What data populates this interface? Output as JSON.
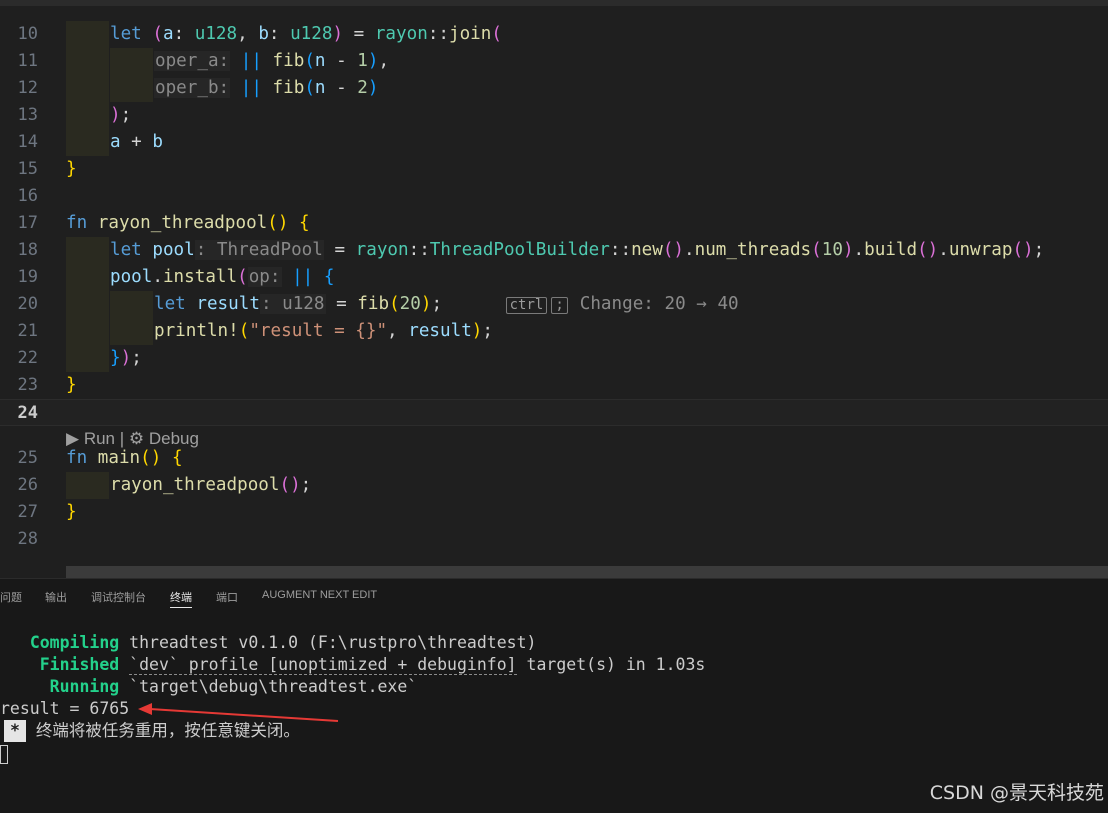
{
  "editor": {
    "lines": [
      {
        "n": "10",
        "spans": [
          [
            "kw",
            "let"
          ],
          [
            "op",
            " "
          ],
          [
            "b2",
            "("
          ],
          [
            "vr",
            "a"
          ],
          [
            "op",
            ": "
          ],
          [
            "ty",
            "u128"
          ],
          [
            "op",
            ", "
          ],
          [
            "vr",
            "b"
          ],
          [
            "op",
            ": "
          ],
          [
            "ty",
            "u128"
          ],
          [
            "b2",
            ")"
          ],
          [
            "op",
            " = "
          ],
          [
            "ty",
            "rayon"
          ],
          [
            "op",
            "::"
          ],
          [
            "fn",
            "join"
          ],
          [
            "b2",
            "("
          ]
        ]
      },
      {
        "n": "11",
        "spans": [
          [
            "ghost",
            "oper_a:"
          ],
          [
            "op",
            " "
          ],
          [
            "b3",
            "||"
          ],
          [
            "op",
            " "
          ],
          [
            "fn",
            "fib"
          ],
          [
            "b3",
            "("
          ],
          [
            "vr",
            "n"
          ],
          [
            "op",
            " - "
          ],
          [
            "nu",
            "1"
          ],
          [
            "b3",
            ")"
          ],
          [
            "op",
            ","
          ]
        ]
      },
      {
        "n": "12",
        "spans": [
          [
            "ghost",
            "oper_b:"
          ],
          [
            "op",
            " "
          ],
          [
            "b3",
            "||"
          ],
          [
            "op",
            " "
          ],
          [
            "fn",
            "fib"
          ],
          [
            "b3",
            "("
          ],
          [
            "vr",
            "n"
          ],
          [
            "op",
            " - "
          ],
          [
            "nu",
            "2"
          ],
          [
            "b3",
            ")"
          ]
        ]
      },
      {
        "n": "13",
        "spans": [
          [
            "b2",
            ")"
          ],
          [
            "op",
            ";"
          ]
        ]
      },
      {
        "n": "14",
        "spans": [
          [
            "vr",
            "a"
          ],
          [
            "op",
            " + "
          ],
          [
            "vr",
            "b"
          ]
        ]
      },
      {
        "n": "15",
        "spans": [
          [
            "b1",
            "}"
          ]
        ]
      },
      {
        "n": "16",
        "spans": []
      },
      {
        "n": "17",
        "spans": [
          [
            "kw",
            "fn"
          ],
          [
            "op",
            " "
          ],
          [
            "fn",
            "rayon_threadpool"
          ],
          [
            "b1",
            "()"
          ],
          [
            "op",
            " "
          ],
          [
            "b1",
            "{"
          ]
        ]
      },
      {
        "n": "18",
        "spans": [
          [
            "kw",
            "let"
          ],
          [
            "op",
            " "
          ],
          [
            "vr",
            "pool"
          ],
          [
            "ghost",
            ": ThreadPool"
          ],
          [
            "op",
            " = "
          ],
          [
            "ty",
            "rayon"
          ],
          [
            "op",
            "::"
          ],
          [
            "ty",
            "ThreadPoolBuilder"
          ],
          [
            "op",
            "::"
          ],
          [
            "fn",
            "new"
          ],
          [
            "b2",
            "()"
          ],
          [
            "op",
            "."
          ],
          [
            "fn",
            "num_threads"
          ],
          [
            "b2",
            "("
          ],
          [
            "nu",
            "10"
          ],
          [
            "b2",
            ")"
          ],
          [
            "op",
            "."
          ],
          [
            "fn",
            "build"
          ],
          [
            "b2",
            "()"
          ],
          [
            "op",
            "."
          ],
          [
            "fn",
            "unwrap"
          ],
          [
            "b2",
            "()"
          ],
          [
            "op",
            ";"
          ]
        ]
      },
      {
        "n": "19",
        "spans": [
          [
            "vr",
            "pool"
          ],
          [
            "op",
            "."
          ],
          [
            "fn",
            "install"
          ],
          [
            "b2",
            "("
          ],
          [
            "ghost",
            "op:"
          ],
          [
            "op",
            " "
          ],
          [
            "b3",
            "||"
          ],
          [
            "op",
            " "
          ],
          [
            "b3",
            "{"
          ]
        ]
      },
      {
        "n": "20",
        "spans": [
          [
            "kw",
            "let"
          ],
          [
            "op",
            " "
          ],
          [
            "vr",
            "result"
          ],
          [
            "ghost",
            ": u128"
          ],
          [
            "op",
            " = "
          ],
          [
            "fn",
            "fib"
          ],
          [
            "b1",
            "("
          ],
          [
            "nu",
            "20"
          ],
          [
            "b1",
            ")"
          ],
          [
            "op",
            ";"
          ]
        ]
      },
      {
        "n": "21",
        "spans": [
          [
            "fn",
            "println!"
          ],
          [
            "b1",
            "("
          ],
          [
            "st",
            "\"result = {}\""
          ],
          [
            "op",
            ", "
          ],
          [
            "vr",
            "result"
          ],
          [
            "b1",
            ")"
          ],
          [
            "op",
            ";"
          ]
        ]
      },
      {
        "n": "22",
        "spans": [
          [
            "b3",
            "}"
          ],
          [
            "b2",
            ")"
          ],
          [
            "op",
            ";"
          ]
        ]
      },
      {
        "n": "23",
        "spans": [
          [
            "b1",
            "}"
          ]
        ]
      },
      {
        "n": "24",
        "spans": []
      },
      {
        "n": "25",
        "spans": [
          [
            "kw",
            "fn"
          ],
          [
            "op",
            " "
          ],
          [
            "fn",
            "main"
          ],
          [
            "b1",
            "()"
          ],
          [
            "op",
            " "
          ],
          [
            "b1",
            "{"
          ]
        ]
      },
      {
        "n": "26",
        "spans": [
          [
            "fn",
            "rayon_threadpool"
          ],
          [
            "b2",
            "()"
          ],
          [
            "op",
            ";"
          ]
        ]
      },
      {
        "n": "27",
        "spans": [
          [
            "b1",
            "}"
          ]
        ]
      },
      {
        "n": "28",
        "spans": []
      }
    ],
    "inline_hint": {
      "key": "ctrl",
      "key2": ";",
      "text": "Change: 20 → 40"
    },
    "codelens": {
      "run": "Run",
      "sep": "|",
      "debug": "Debug"
    }
  },
  "panel": {
    "tabs": [
      "问题",
      "输出",
      "调试控制台",
      "终端",
      "端口",
      "AUGMENT NEXT EDIT"
    ],
    "active_tab": "终端",
    "terminal": {
      "compiling_label": "Compiling",
      "compiling_text": "threadtest v0.1.0 (F:\\rustpro\\threadtest)",
      "finished_label": "Finished",
      "finished_text_a": "`dev` profile [unoptimized + debuginfo]",
      "finished_text_b": "target(s) in 1.03s",
      "running_label": "Running",
      "running_text": "`target\\debug\\threadtest.exe`",
      "result": "result = 6765",
      "badge": "*",
      "reuse_msg": "终端将被任务重用，按任意键关闭。"
    }
  },
  "watermark": "CSDN @景天科技苑",
  "colors": {
    "accent_arrow": "#e53935",
    "terminal_green": "#23d18b"
  }
}
